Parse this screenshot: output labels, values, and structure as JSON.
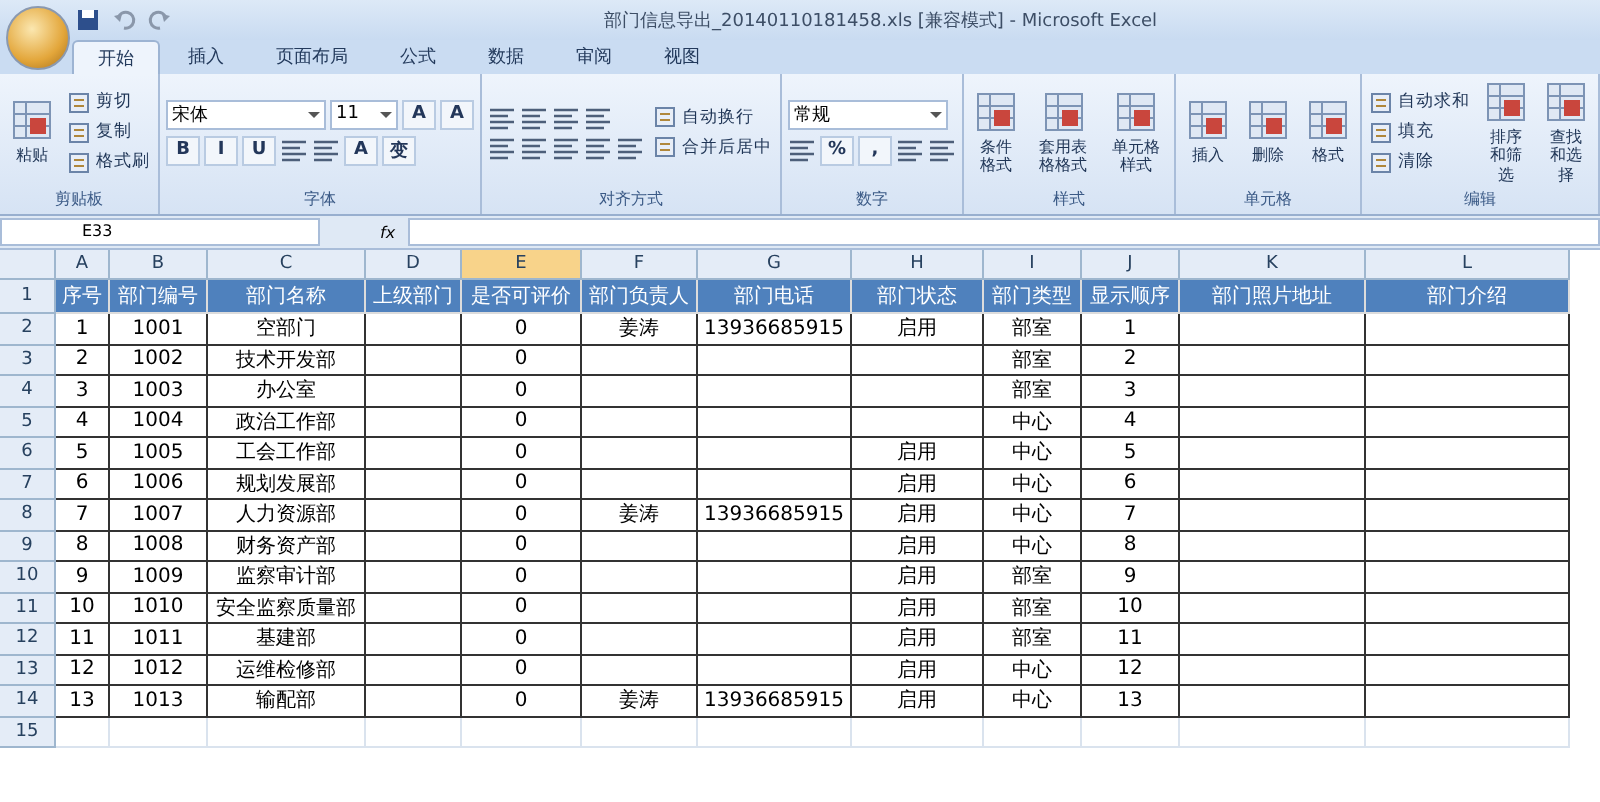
{
  "window": {
    "title": "部门信息导出_20140110181458.xls  [兼容模式] - Microsoft Excel"
  },
  "tabs": [
    {
      "label": "开始",
      "selected": true
    },
    {
      "label": "插入",
      "selected": false
    },
    {
      "label": "页面布局",
      "selected": false
    },
    {
      "label": "公式",
      "selected": false
    },
    {
      "label": "数据",
      "selected": false
    },
    {
      "label": "审阅",
      "selected": false
    },
    {
      "label": "视图",
      "selected": false
    }
  ],
  "ribbon": [
    {
      "label": "剪贴板",
      "columns": [
        [
          [
            {
              "kind": "large",
              "label": "粘贴"
            }
          ]
        ],
        [
          [
            {
              "kind": "small",
              "label": "剪切"
            }
          ],
          [
            {
              "kind": "small",
              "label": "复制"
            }
          ],
          [
            {
              "kind": "small",
              "label": "格式刷"
            }
          ]
        ]
      ]
    },
    {
      "label": "字体",
      "columns": [
        [
          [
            {
              "kind": "combo",
              "label": "宋体"
            },
            {
              "kind": "field",
              "label": "11"
            },
            {
              "kind": "glyph",
              "label": "A"
            },
            {
              "kind": "glyph",
              "label": "A"
            }
          ],
          [
            {
              "kind": "glyph",
              "label": "B"
            },
            {
              "kind": "glyph",
              "label": "I"
            },
            {
              "kind": "glyph",
              "label": "U"
            },
            {
              "kind": "icon"
            },
            {
              "kind": "icon"
            },
            {
              "kind": "glyph",
              "label": "A"
            },
            {
              "kind": "glyph",
              "label": "变"
            }
          ]
        ]
      ]
    },
    {
      "label": "对齐方式",
      "columns": [
        [
          [
            {
              "kind": "icon"
            },
            {
              "kind": "icon"
            },
            {
              "kind": "icon"
            },
            {
              "kind": "icon"
            }
          ],
          [
            {
              "kind": "icon"
            },
            {
              "kind": "icon"
            },
            {
              "kind": "icon"
            },
            {
              "kind": "icon"
            },
            {
              "kind": "icon"
            }
          ]
        ],
        [
          [
            {
              "kind": "small",
              "label": "自动换行"
            }
          ],
          [
            {
              "kind": "small",
              "label": "合并后居中"
            }
          ]
        ]
      ]
    },
    {
      "label": "数字",
      "columns": [
        [
          [
            {
              "kind": "combo",
              "label": "常规"
            }
          ],
          [
            {
              "kind": "icon"
            },
            {
              "kind": "glyph",
              "label": "%"
            },
            {
              "kind": "glyph",
              "label": ","
            },
            {
              "kind": "icon"
            },
            {
              "kind": "icon"
            }
          ]
        ]
      ]
    },
    {
      "label": "样式",
      "columns": [
        [
          [
            {
              "kind": "large",
              "label": "条件格式"
            }
          ]
        ],
        [
          [
            {
              "kind": "large",
              "label": "套用表格格式"
            }
          ]
        ],
        [
          [
            {
              "kind": "large",
              "label": "单元格样式"
            }
          ]
        ]
      ]
    },
    {
      "label": "单元格",
      "columns": [
        [
          [
            {
              "kind": "large",
              "label": "插入"
            }
          ]
        ],
        [
          [
            {
              "kind": "large",
              "label": "删除"
            }
          ]
        ],
        [
          [
            {
              "kind": "large",
              "label": "格式"
            }
          ]
        ]
      ]
    },
    {
      "label": "编辑",
      "columns": [
        [
          [
            {
              "kind": "small",
              "label": "自动求和"
            }
          ],
          [
            {
              "kind": "small",
              "label": "填充"
            }
          ],
          [
            {
              "kind": "small",
              "label": "清除"
            }
          ]
        ],
        [
          [
            {
              "kind": "large",
              "label": "排序和筛选"
            }
          ]
        ],
        [
          [
            {
              "kind": "large",
              "label": "查找和选择"
            }
          ]
        ]
      ]
    }
  ],
  "formula_bar": {
    "name_box": "E33",
    "function_label": "fx"
  },
  "columns": [
    {
      "letter": "A",
      "selected": false
    },
    {
      "letter": "B",
      "selected": false
    },
    {
      "letter": "C",
      "selected": false
    },
    {
      "letter": "D",
      "selected": false
    },
    {
      "letter": "E",
      "selected": true
    },
    {
      "letter": "F",
      "selected": false
    },
    {
      "letter": "G",
      "selected": false
    },
    {
      "letter": "H",
      "selected": false
    },
    {
      "letter": "I",
      "selected": false
    },
    {
      "letter": "J",
      "selected": false
    },
    {
      "letter": "K",
      "selected": false
    },
    {
      "letter": "L",
      "selected": false
    }
  ],
  "rows": [
    {
      "header": "1",
      "kind": "heading",
      "cells": [
        "序号",
        "部门编号",
        "部门名称",
        "上级部门",
        "是否可评价",
        "部门负责人",
        "部门电话",
        "部门状态",
        "部门类型",
        "显示顺序",
        "部门照片地址",
        "部门介绍"
      ]
    },
    {
      "header": "2",
      "kind": "data",
      "cells": [
        "1",
        "1001",
        "空部门",
        null,
        "0",
        "姜涛",
        "13936685915",
        "启用",
        "部室",
        "1",
        null,
        null
      ]
    },
    {
      "header": "3",
      "kind": "data",
      "cells": [
        "2",
        "1002",
        "技术开发部",
        null,
        "0",
        null,
        null,
        null,
        "部室",
        "2",
        null,
        null
      ]
    },
    {
      "header": "4",
      "kind": "data",
      "cells": [
        "3",
        "1003",
        "办公室",
        null,
        "0",
        null,
        null,
        null,
        "部室",
        "3",
        null,
        null
      ]
    },
    {
      "header": "5",
      "kind": "data",
      "cells": [
        "4",
        "1004",
        "政治工作部",
        null,
        "0",
        null,
        null,
        null,
        "中心",
        "4",
        null,
        null
      ]
    },
    {
      "header": "6",
      "kind": "data",
      "cells": [
        "5",
        "1005",
        "工会工作部",
        null,
        "0",
        null,
        null,
        "启用",
        "中心",
        "5",
        null,
        null
      ]
    },
    {
      "header": "7",
      "kind": "data",
      "cells": [
        "6",
        "1006",
        "规划发展部",
        null,
        "0",
        null,
        null,
        "启用",
        "中心",
        "6",
        null,
        null
      ]
    },
    {
      "header": "8",
      "kind": "data",
      "cells": [
        "7",
        "1007",
        "人力资源部",
        null,
        "0",
        "姜涛",
        "13936685915",
        "启用",
        "中心",
        "7",
        null,
        null
      ]
    },
    {
      "header": "9",
      "kind": "data",
      "cells": [
        "8",
        "1008",
        "财务资产部",
        null,
        "0",
        null,
        null,
        "启用",
        "中心",
        "8",
        null,
        null
      ]
    },
    {
      "header": "10",
      "kind": "data",
      "cells": [
        "9",
        "1009",
        "监察审计部",
        null,
        "0",
        null,
        null,
        "启用",
        "部室",
        "9",
        null,
        null
      ]
    },
    {
      "header": "11",
      "kind": "data",
      "cells": [
        "10",
        "1010",
        "安全监察质量部",
        null,
        "0",
        null,
        null,
        "启用",
        "部室",
        "10",
        null,
        null
      ]
    },
    {
      "header": "12",
      "kind": "data",
      "cells": [
        "11",
        "1011",
        "基建部",
        null,
        "0",
        null,
        null,
        "启用",
        "部室",
        "11",
        null,
        null
      ]
    },
    {
      "header": "13",
      "kind": "data",
      "cells": [
        "12",
        "1012",
        "运维检修部",
        null,
        "0",
        null,
        null,
        "启用",
        "中心",
        "12",
        null,
        null
      ]
    },
    {
      "header": "14",
      "kind": "data",
      "cells": [
        "13",
        "1013",
        "输配部",
        null,
        "0",
        "姜涛",
        "13936685915",
        "启用",
        "中心",
        "13",
        null,
        null
      ]
    },
    {
      "header": "15",
      "kind": "empty"
    }
  ]
}
